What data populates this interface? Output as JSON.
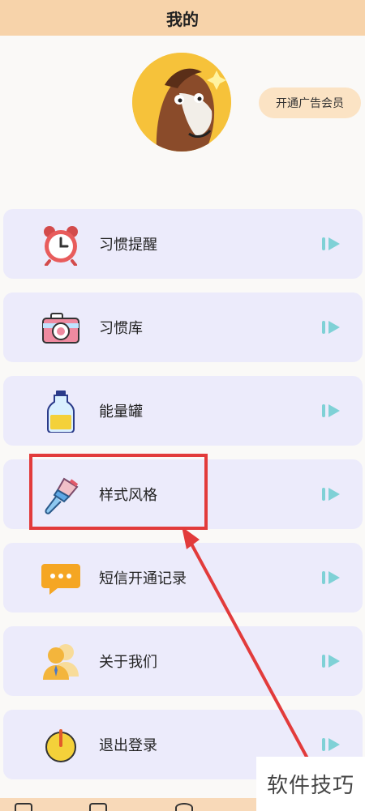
{
  "header": {
    "title": "我的"
  },
  "profile": {
    "vip_button": "开通广告会员"
  },
  "menu": [
    {
      "label": "习惯提醒",
      "icon": "alarm-clock-icon"
    },
    {
      "label": "习惯库",
      "icon": "camera-icon"
    },
    {
      "label": "能量罐",
      "icon": "bottle-icon"
    },
    {
      "label": "样式风格",
      "icon": "paint-brush-icon"
    },
    {
      "label": "短信开通记录",
      "icon": "message-bubble-icon"
    },
    {
      "label": "关于我们",
      "icon": "people-icon"
    },
    {
      "label": "退出登录",
      "icon": "power-icon"
    }
  ],
  "watermark": {
    "text": "软件技巧"
  },
  "colors": {
    "header_bg": "#f7d3aa",
    "menu_bg": "#ecebfb",
    "arrow_color": "#7fd1d6",
    "highlight_red": "#e23b3b"
  }
}
